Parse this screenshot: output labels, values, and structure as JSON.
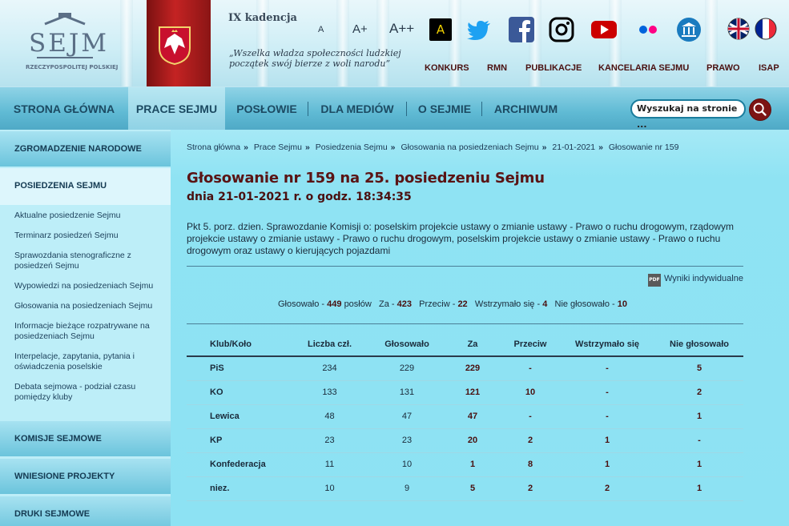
{
  "header": {
    "logo_text": "SEJM",
    "logo_sub": "RZECZYPOSPOLITEJ POLSKIEJ",
    "kadencja": "IX kadencja",
    "motto": "„Wszelka władza społeczności ludzkiej początek swój bierze z woli narodu”",
    "font_a": "A",
    "font_aplus": "A+",
    "font_aplusplus": "A++",
    "contrast": "A",
    "top_links": [
      "KONKURS",
      "RMN",
      "PUBLIKACJE",
      "KANCELARIA SEJMU",
      "PRAWO",
      "ISAP"
    ]
  },
  "menu": {
    "items": [
      "STRONA GŁÓWNA",
      "PRACE SEJMU",
      "POSŁOWIE",
      "DLA MEDIÓW",
      "O SEJMIE",
      "ARCHIWUM"
    ],
    "search_placeholder": "Wyszukaj na stronie ..."
  },
  "sidebar": {
    "sections": [
      "ZGROMADZENIE NARODOWE",
      "POSIEDZENIA SEJMU",
      "KOMISJE SEJMOWE",
      "WNIESIONE PROJEKTY",
      "DRUKI SEJMOWE"
    ],
    "items": [
      "Aktualne posiedzenie Sejmu",
      "Terminarz posiedzeń Sejmu",
      "Sprawozdania stenograficzne z posiedzeń Sejmu",
      "Wypowiedzi na posiedzeniach Sejmu",
      "Głosowania na posiedzeniach Sejmu",
      "Informacje bieżące rozpatrywane na posiedzeniach Sejmu",
      "Interpelacje, zapytania, pytania i oświadczenia poselskie",
      "Debata sejmowa - podział czasu pomiędzy kluby"
    ]
  },
  "breadcrumb": [
    "Strona główna",
    "Prace Sejmu",
    "Posiedzenia Sejmu",
    "Głosowania na posiedzeniach Sejmu",
    "21-01-2021",
    "Głosowanie nr 159"
  ],
  "vote": {
    "title": "Głosowanie nr 159 na 25. posiedzeniu Sejmu",
    "subtitle": "dnia 21-01-2021 r. o godz. 18:34:35",
    "description": "Pkt 5. porz. dzien. Sprawozdanie Komisji o: poselskim projekcie ustawy o zmianie ustawy - Prawo o ruchu drogowym, rządowym projekcie ustawy o zmianie ustawy - Prawo o ruchu drogowym, poselskim projekcie ustawy o zmianie ustawy - Prawo o ruchu drogowym oraz ustawy o kierujących pojazdami",
    "pdf_link": "Wyniki indywidualne",
    "pdf_icon": "PDF",
    "summary": {
      "glosowalo_label": "Głosowało -",
      "glosowalo": "449",
      "poslow": "posłów",
      "za_label": "Za -",
      "za": "423",
      "przeciw_label": "Przeciw -",
      "przeciw": "22",
      "wstrzymalo_label": "Wstrzymało się -",
      "wstrzymalo": "4",
      "nie_label": "Nie głosowało -",
      "nie": "10"
    },
    "table": {
      "headers": [
        "Klub/Koło",
        "Liczba czł.",
        "Głosowało",
        "Za",
        "Przeciw",
        "Wstrzymało się",
        "Nie głosowało"
      ],
      "rows": [
        [
          "PiS",
          "234",
          "229",
          "229",
          "-",
          "-",
          "5"
        ],
        [
          "KO",
          "133",
          "131",
          "121",
          "10",
          "-",
          "2"
        ],
        [
          "Lewica",
          "48",
          "47",
          "47",
          "-",
          "-",
          "1"
        ],
        [
          "KP",
          "23",
          "23",
          "20",
          "2",
          "1",
          "-"
        ],
        [
          "Konfederacja",
          "11",
          "10",
          "1",
          "8",
          "1",
          "1"
        ],
        [
          "niez.",
          "10",
          "9",
          "5",
          "2",
          "2",
          "1"
        ]
      ]
    }
  },
  "colors": {
    "accent": "#5a1414",
    "menu": "#5fbad4",
    "content_bg": "#8fe3f3"
  }
}
